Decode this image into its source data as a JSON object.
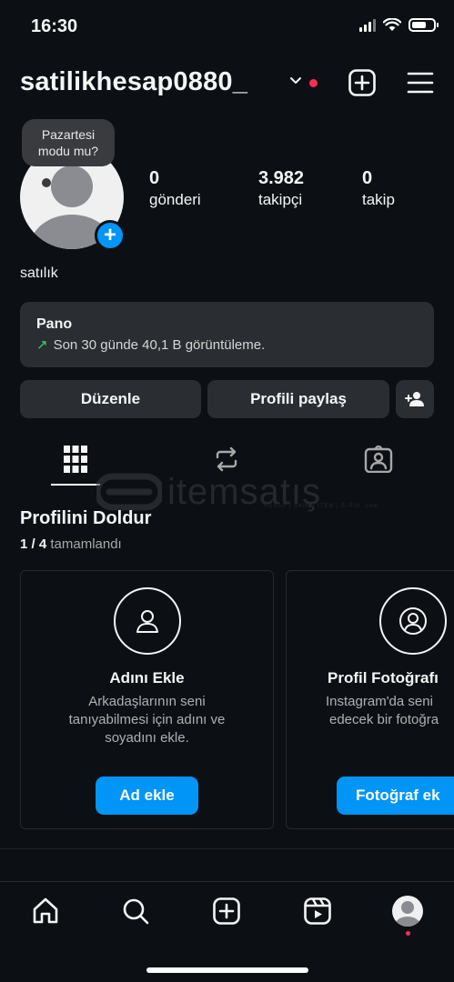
{
  "status_bar": {
    "time": "16:30"
  },
  "header": {
    "username": "satilikhesap0880_",
    "icons": [
      "chevron-down-icon",
      "new-post-icon",
      "menu-icon"
    ]
  },
  "profile": {
    "bubble_line1": "Pazartesi",
    "bubble_line2": "modu mu?",
    "bio": "satılık"
  },
  "stats": [
    {
      "value": "0",
      "label": "gönderi"
    },
    {
      "value": "3.982",
      "label": "takipçi"
    },
    {
      "value": "0",
      "label": "takip"
    }
  ],
  "pano": {
    "title": "Pano",
    "subtitle": "Son 30 günde 40,1 B görüntüleme."
  },
  "buttons": {
    "edit": "Düzenle",
    "share": "Profili paylaş"
  },
  "tabs": [
    "grid-icon",
    "reposts-icon",
    "tagged-icon"
  ],
  "watermark": {
    "text": "itemsatış",
    "sub": "HESAP | SKIN | ITEM | E-PIN .com"
  },
  "complete_profile": {
    "title": "Profilini Doldur",
    "progress_done": "1 / 4",
    "progress_label": "tamamlandı",
    "cards": [
      {
        "title": "Adını Ekle",
        "desc1": "Arkadaşlarının seni",
        "desc2": "tanıyabilmesi için adını ve",
        "desc3": "soyadını ekle.",
        "button": "Ad ekle"
      },
      {
        "title": "Profil Fotoğrafı",
        "desc1": "Instagram'da seni",
        "desc2": "edecek bir fotoğra",
        "desc3": "",
        "button": "Fotoğraf ek"
      }
    ]
  },
  "nav": [
    "home-icon",
    "search-icon",
    "create-icon",
    "reels-icon",
    "profile-avatar"
  ],
  "colors": {
    "accent": "#0095f6",
    "background": "#0c1014",
    "card": "#2a2d31",
    "notification": "#ff2d55"
  }
}
